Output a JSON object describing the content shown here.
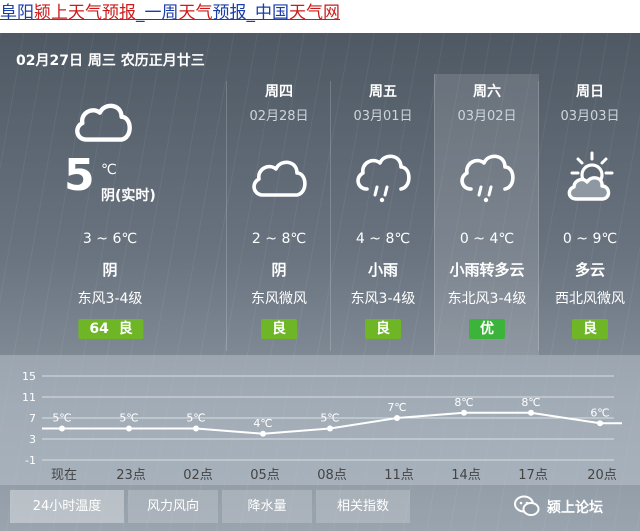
{
  "header": {
    "part1": "阜阳",
    "part2": "颍上天气预报",
    "part3": "_一周",
    "part4": "天气",
    "part5": "预报",
    "part6": "_中国",
    "part7": "天气网"
  },
  "today": {
    "date_line": "02月27日 周三 农历正月廿三",
    "temperature": "5",
    "unit": "℃",
    "realtime": "阴(实时)",
    "range": "3 ~ 6℃",
    "condition": "阴",
    "wind": "东风3-4级",
    "aqi_value": "64",
    "aqi_label": "良",
    "icon": "cloud-icon"
  },
  "forecast": [
    {
      "weekday": "周四",
      "date": "02月28日",
      "range": "2 ~ 8℃",
      "condition": "阴",
      "wind": "东风微风",
      "aqi": "良",
      "icon": "cloud-icon"
    },
    {
      "weekday": "周五",
      "date": "03月01日",
      "range": "4 ~ 8℃",
      "condition": "小雨",
      "wind": "东风3-4级",
      "aqi": "良",
      "icon": "light-rain-icon"
    },
    {
      "weekday": "周六",
      "date": "03月02日",
      "range": "0 ~ 4℃",
      "condition": "小雨转多云",
      "wind": "东北风3-4级",
      "aqi": "优",
      "icon": "light-rain-icon"
    },
    {
      "weekday": "周日",
      "date": "03月03日",
      "range": "0 ~ 9℃",
      "condition": "多云",
      "wind": "西北风微风",
      "aqi": "良",
      "icon": "partly-cloudy-icon"
    }
  ],
  "chart_data": {
    "type": "line",
    "x": [
      "现在",
      "23点",
      "02点",
      "05点",
      "08点",
      "11点",
      "14点",
      "17点",
      "20点"
    ],
    "values": [
      5,
      5,
      5,
      4,
      5,
      7,
      8,
      8,
      6
    ],
    "point_labels": [
      "5℃",
      "5℃",
      "5℃",
      "4℃",
      "5℃",
      "7℃",
      "8℃",
      "8℃",
      "6℃"
    ],
    "y_ticks": [
      "15",
      "11",
      "7",
      "3",
      "-1"
    ],
    "ylim": [
      -1,
      15
    ],
    "grid": true,
    "colors": {
      "line": "#ffffff",
      "grid": "#d7dde3",
      "labels": "#444444"
    }
  },
  "tabs": [
    "24小时温度",
    "风力风向",
    "降水量",
    "相关指数"
  ],
  "watermark": {
    "text": "颍上论坛",
    "icon": "wechat-icon"
  }
}
